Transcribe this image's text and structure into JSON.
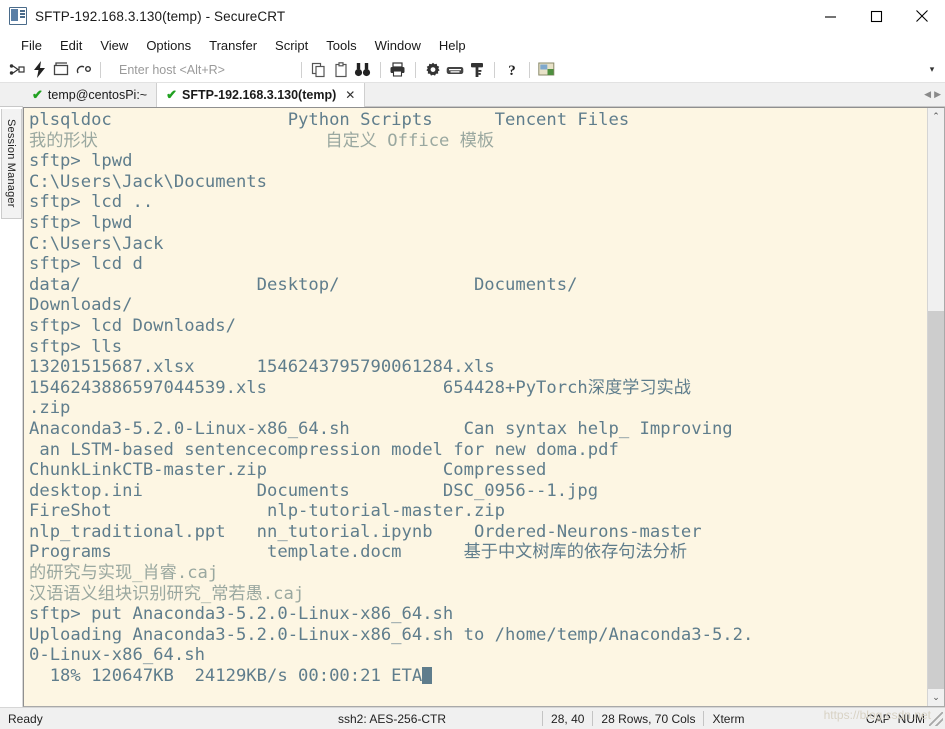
{
  "window": {
    "title": "SFTP-192.168.3.130(temp) - SecureCRT",
    "icon": "securecrt-app-icon",
    "controls": {
      "minimize": "—",
      "maximize": "□",
      "close": "✕"
    }
  },
  "menubar": {
    "items": [
      {
        "label": "File"
      },
      {
        "label": "Edit"
      },
      {
        "label": "View"
      },
      {
        "label": "Options"
      },
      {
        "label": "Transfer"
      },
      {
        "label": "Script"
      },
      {
        "label": "Tools"
      },
      {
        "label": "Window"
      },
      {
        "label": "Help"
      }
    ]
  },
  "toolbar": {
    "host_placeholder": "Enter host <Alt+R>",
    "icons": [
      {
        "name": "connect-icon"
      },
      {
        "name": "quick-connect-icon"
      },
      {
        "name": "connect-in-tab-icon"
      },
      {
        "name": "reconnect-icon"
      },
      {
        "name": "copy-icon"
      },
      {
        "name": "paste-icon"
      },
      {
        "name": "find-icon"
      },
      {
        "name": "print-icon"
      },
      {
        "name": "gear-icon"
      },
      {
        "name": "keyboard-icon"
      },
      {
        "name": "key-icon"
      },
      {
        "name": "help-icon"
      },
      {
        "name": "session-options-icon"
      }
    ],
    "overflow_label": "▾"
  },
  "tabs": {
    "items": [
      {
        "label": "temp@centosPi:~",
        "active": false,
        "status": "connected",
        "check": "✔"
      },
      {
        "label": "SFTP-192.168.3.130(temp)",
        "active": true,
        "status": "connected",
        "check": "✔",
        "close": "✕"
      }
    ],
    "nav_prev": "◀",
    "nav_next": "▶"
  },
  "sidebar": {
    "label": "Session Manager"
  },
  "terminal": {
    "background": "#fdf6e3",
    "foreground": "#5f7d8c",
    "cjk_foreground": "#9aa8a0",
    "cursor": "block",
    "lines": [
      {
        "text": "plsqldoc                 Python Scripts      Tencent Files",
        "cjk": false
      },
      {
        "text": "我的形状                      自定义 Office 模板",
        "cjk": true
      },
      {
        "text": "sftp> lpwd",
        "cjk": false
      },
      {
        "text": "C:\\Users\\Jack\\Documents",
        "cjk": false
      },
      {
        "text": "sftp> lcd ..",
        "cjk": false
      },
      {
        "text": "sftp> lpwd",
        "cjk": false
      },
      {
        "text": "C:\\Users\\Jack",
        "cjk": false
      },
      {
        "text": "sftp> lcd d",
        "cjk": false
      },
      {
        "text": "data/                 Desktop/             Documents/",
        "cjk": false
      },
      {
        "text": "Downloads/",
        "cjk": false
      },
      {
        "text": "sftp> lcd Downloads/",
        "cjk": false
      },
      {
        "text": "sftp> lls",
        "cjk": false
      },
      {
        "text": "13201515687.xlsx      1546243795790061284.xls",
        "cjk": false
      },
      {
        "text": "1546243886597044539.xls                 654428+PyTorch深度学习实战",
        "cjk": false
      },
      {
        "text": ".zip",
        "cjk": false
      },
      {
        "text": "Anaconda3-5.2.0-Linux-x86_64.sh           Can syntax help_ Improving",
        "cjk": false
      },
      {
        "text": " an LSTM-based sentencecompression model for new doma.pdf",
        "cjk": false
      },
      {
        "text": "ChunkLinkCTB-master.zip                 Compressed",
        "cjk": false
      },
      {
        "text": "desktop.ini           Documents         DSC_0956--1.jpg",
        "cjk": false
      },
      {
        "text": "FireShot               nlp-tutorial-master.zip",
        "cjk": false
      },
      {
        "text": "nlp_traditional.ppt   nn_tutorial.ipynb    Ordered-Neurons-master",
        "cjk": false
      },
      {
        "text": "Programs               template.docm      基于中文树库的依存句法分析",
        "cjk": false
      },
      {
        "text": "的研究与实现_肖睿.caj",
        "cjk": true
      },
      {
        "text": "汉语语义组块识别研究_常若愚.caj",
        "cjk": true
      },
      {
        "text": "sftp> put Anaconda3-5.2.0-Linux-x86_64.sh",
        "cjk": false
      },
      {
        "text": "Uploading Anaconda3-5.2.0-Linux-x86_64.sh to /home/temp/Anaconda3-5.2.",
        "cjk": false
      },
      {
        "text": "0-Linux-x86_64.sh",
        "cjk": false
      }
    ],
    "progress_line": "  18% 120647KB  24129KB/s 00:00:21 ETA",
    "transfer": {
      "percent": "18%",
      "transferred": "120647KB",
      "speed": "24129KB/s",
      "eta_time": "00:00:21",
      "eta_label": "ETA"
    },
    "scrollbar": {
      "up": "⌃",
      "down": "⌄"
    }
  },
  "statusbar": {
    "ready": "Ready",
    "cipher": "ssh2: AES-256-CTR",
    "cursor_pos": "28, 40",
    "dimensions": "28 Rows, 70 Cols",
    "emulation": "Xterm",
    "cap": "CAP",
    "num": "NUM",
    "watermark": "https://blog.csdn.net"
  }
}
